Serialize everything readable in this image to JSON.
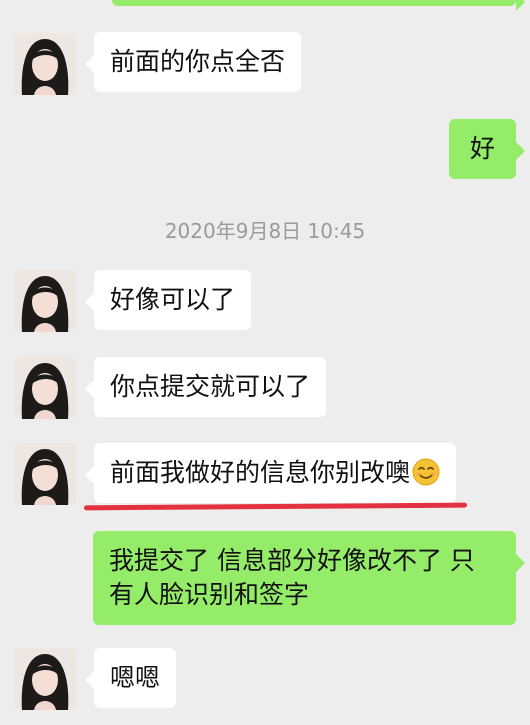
{
  "messages": {
    "m1": {
      "direction": "incoming",
      "text": "前面的你点全否"
    },
    "m2": {
      "direction": "outgoing",
      "text": "好"
    },
    "timestamp": "2020年9月8日 10:45",
    "m3": {
      "direction": "incoming",
      "text": "好像可以了"
    },
    "m4": {
      "direction": "incoming",
      "text": "你点提交就可以了"
    },
    "m5": {
      "direction": "incoming",
      "text": "前面我做好的信息你别改噢",
      "emoji": "smiling-face-emoji"
    },
    "m6": {
      "direction": "outgoing",
      "line1": "我提交了  信息部分好像改不了  只",
      "line2": "有人脸识别和签字"
    },
    "m7": {
      "direction": "incoming",
      "text": "嗯嗯"
    }
  },
  "colors": {
    "background": "#ededed",
    "incoming_bubble": "#ffffff",
    "outgoing_bubble": "#95ec69",
    "highlight_underline": "#e4313f",
    "timestamp_text": "#9a9a9a"
  }
}
